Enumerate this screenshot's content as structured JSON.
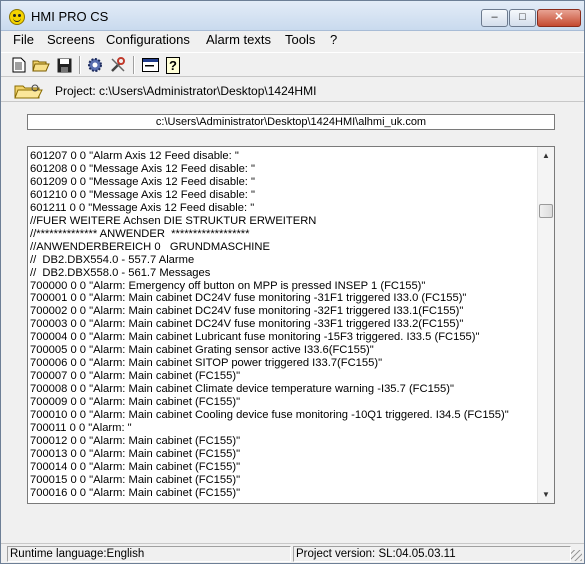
{
  "window": {
    "title": "HMI PRO CS",
    "min_label": "–",
    "max_label": "□",
    "close_label": "✕"
  },
  "menu": [
    {
      "label": "File"
    },
    {
      "label": "Screens"
    },
    {
      "label": "Configurations"
    },
    {
      "label": "Alarm texts"
    },
    {
      "label": "Tools"
    },
    {
      "label": "?"
    }
  ],
  "toolbar": {
    "icons": [
      "new-file-icon",
      "open-folder-icon",
      "save-icon",
      "settings-gear-icon",
      "tools-icon",
      "window-icon",
      "help-icon"
    ]
  },
  "project": {
    "label": "Project: c:\\Users\\Administrator\\Desktop\\1424HMI"
  },
  "path": {
    "value": "c:\\Users\\Administrator\\Desktop\\1424HMI\\alhmi_uk.com"
  },
  "editor": {
    "lines": [
      "601207 0 0 \"Alarm Axis 12 Feed disable: \"",
      "601208 0 0 \"Message Axis 12 Feed disable: \"",
      "601209 0 0 \"Message Axis 12 Feed disable: \"",
      "601210 0 0 \"Message Axis 12 Feed disable: \"",
      "601211 0 0 \"Message Axis 12 Feed disable: \"",
      "//FUER WEITERE Achsen DIE STRUKTUR ERWEITERN",
      "//************** ANWENDER  ******************",
      "//ANWENDERBEREICH 0   GRUNDMASCHINE",
      "//  DB2.DBX554.0 - 557.7 Alarme",
      "//  DB2.DBX558.0 - 561.7 Messages",
      "700000 0 0 \"Alarm: Emergency off button on MPP is pressed INSEP 1 (FC155)\"",
      "700001 0 0 \"Alarm: Main cabinet DC24V fuse monitoring -31F1 triggered I33.0 (FC155)\"",
      "700002 0 0 \"Alarm: Main cabinet DC24V fuse monitoring -32F1 triggered I33.1(FC155)\"",
      "700003 0 0 \"Alarm: Main cabinet DC24V fuse monitoring -33F1 triggered I33.2(FC155)\"",
      "700004 0 0 \"Alarm: Main cabinet Lubricant fuse monitoring -15F3 triggered. I33.5 (FC155)\"",
      "700005 0 0 \"Alarm: Main cabinet Grating sensor active I33.6(FC155)\"",
      "700006 0 0 \"Alarm: Main cabinet SITOP power triggered I33.7(FC155)\"",
      "700007 0 0 \"Alarm: Main cabinet (FC155)\"",
      "700008 0 0 \"Alarm: Main cabinet Climate device temperature warning -I35.7 (FC155)\"",
      "700009 0 0 \"Alarm: Main cabinet (FC155)\"",
      "700010 0 0 \"Alarm: Main cabinet Cooling device fuse monitoring -10Q1 triggered. I34.5 (FC155)\"",
      "700011 0 0 \"Alarm: \"",
      "700012 0 0 \"Alarm: Main cabinet (FC155)\"",
      "700013 0 0 \"Alarm: Main cabinet (FC155)\"",
      "700014 0 0 \"Alarm: Main cabinet (FC155)\"",
      "700015 0 0 \"Alarm: Main cabinet (FC155)\"",
      "700016 0 0 \"Alarm: Main cabinet (FC155)\""
    ]
  },
  "status": {
    "language": "Runtime language:English",
    "version": "Project version: SL:04.05.03.11"
  }
}
